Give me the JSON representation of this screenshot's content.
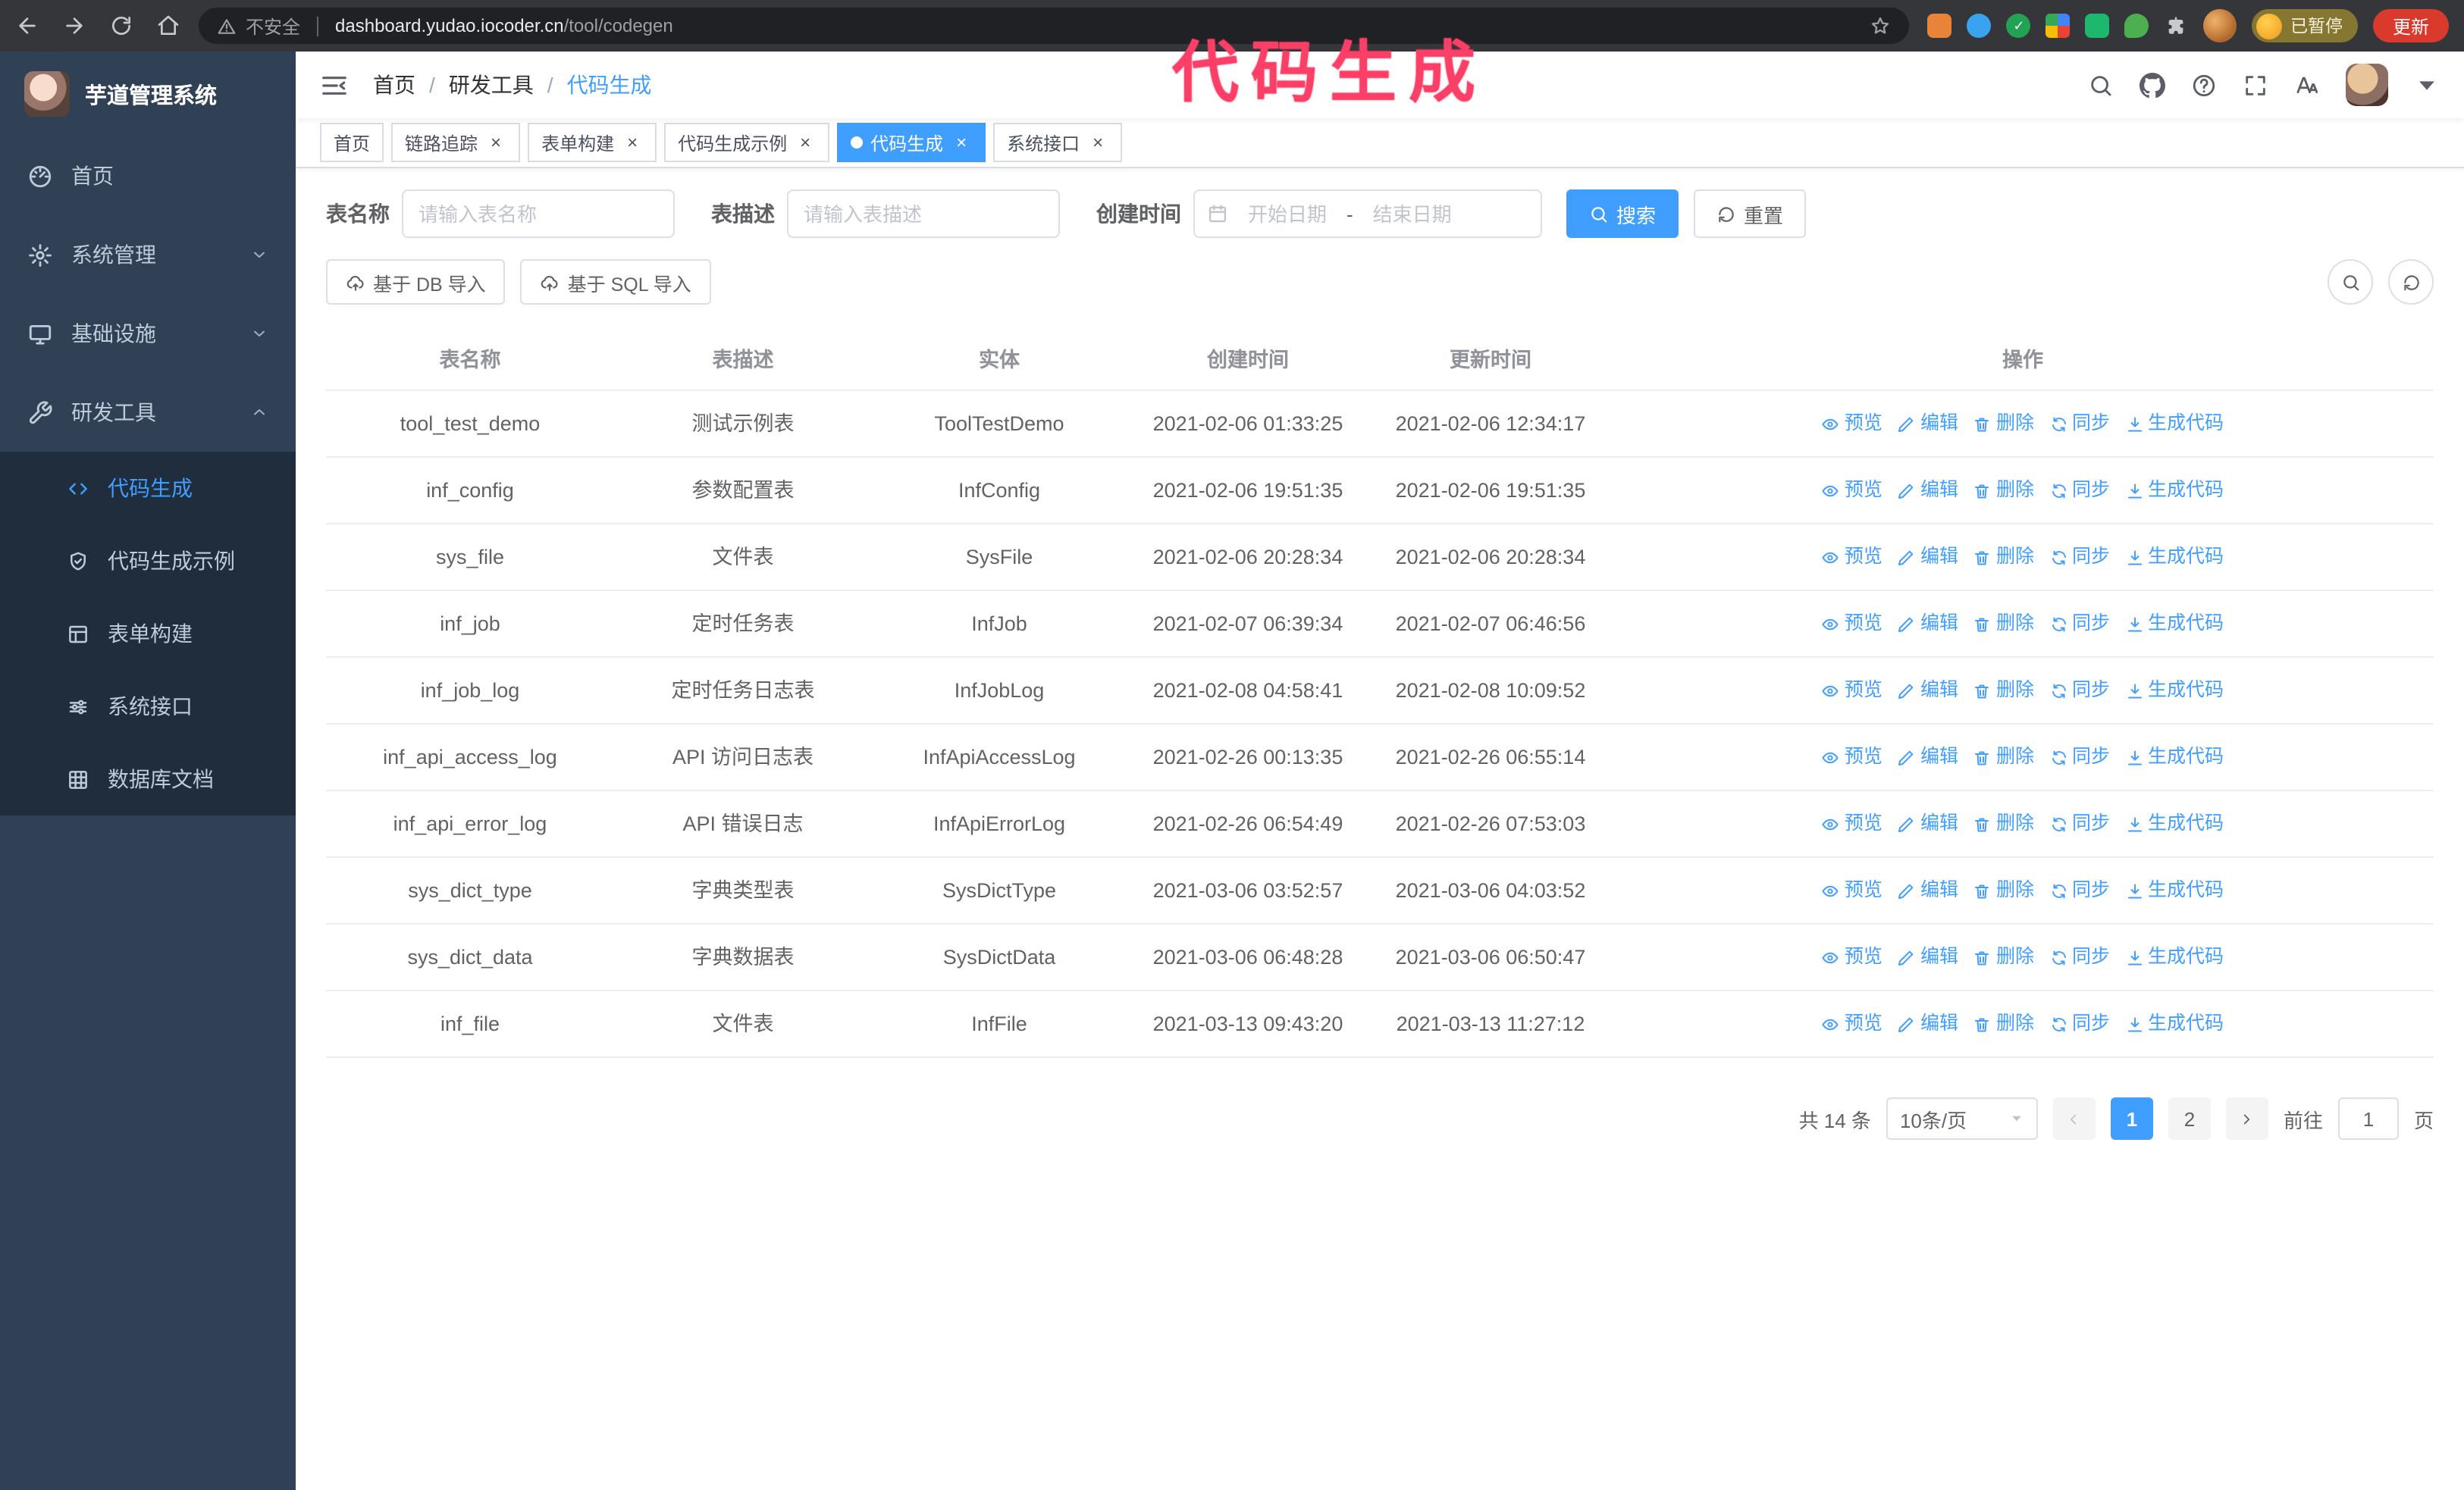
{
  "annotation": {
    "text": "代码生成",
    "color": "#fb3f66"
  },
  "browser": {
    "security_label": "不安全",
    "url_host": "dashboard.yudao.iocoder.cn",
    "url_path": "/tool/codegen",
    "profile_badge": "已暂停",
    "update_button": "更新",
    "extensions": [
      "orange-extension-icon",
      "blue-drop-extension-icon",
      "green-check-extension-icon",
      "people-extension-icon",
      "green-card-extension-icon",
      "leaf-extension-icon",
      "puzzle-icon"
    ]
  },
  "sidebar": {
    "logo_title": "芋道管理系统",
    "items": [
      {
        "label": "首页",
        "icon": "dashboard-icon"
      },
      {
        "label": "系统管理",
        "icon": "gear-icon"
      },
      {
        "label": "基础设施",
        "icon": "monitor-icon"
      },
      {
        "label": "研发工具",
        "icon": "wrench-icon"
      }
    ],
    "submenu": [
      {
        "label": "代码生成",
        "icon": "code-icon",
        "active": true
      },
      {
        "label": "代码生成示例",
        "icon": "shield-check-icon"
      },
      {
        "label": "表单构建",
        "icon": "form-icon"
      },
      {
        "label": "系统接口",
        "icon": "sliders-icon"
      },
      {
        "label": "数据库文档",
        "icon": "grid-icon"
      }
    ]
  },
  "navbar": {
    "breadcrumb": [
      "首页",
      "研发工具",
      "代码生成"
    ],
    "separator": "/"
  },
  "tabs": [
    {
      "label": "首页"
    },
    {
      "label": "链路追踪"
    },
    {
      "label": "表单构建"
    },
    {
      "label": "代码生成示例"
    },
    {
      "label": "代码生成"
    },
    {
      "label": "系统接口"
    }
  ],
  "filters": {
    "table_name_label": "表名称",
    "table_name_placeholder": "请输入表名称",
    "table_desc_label": "表描述",
    "table_desc_placeholder": "请输入表描述",
    "create_time_label": "创建时间",
    "date_start_placeholder": "开始日期",
    "date_separator": "-",
    "date_end_placeholder": "结束日期",
    "search_button": "搜索",
    "reset_button": "重置"
  },
  "toolbar": {
    "import_db": "基于 DB 导入",
    "import_sql": "基于 SQL 导入"
  },
  "table": {
    "columns": [
      "表名称",
      "表描述",
      "实体",
      "创建时间",
      "更新时间",
      "操作"
    ],
    "actions": [
      {
        "label": "预览",
        "icon": "eye",
        "name": "preview-action"
      },
      {
        "label": "编辑",
        "icon": "pen",
        "name": "edit-action"
      },
      {
        "label": "删除",
        "icon": "trash",
        "name": "delete-action"
      },
      {
        "label": "同步",
        "icon": "sync",
        "name": "sync-action"
      },
      {
        "label": "生成代码",
        "icon": "download",
        "name": "generate-code-action"
      }
    ],
    "rows": [
      {
        "name": "tool_test_demo",
        "desc": "测试示例表",
        "entity": "ToolTestDemo",
        "created": "2021-02-06 01:33:25",
        "updated": "2021-02-06 12:34:17"
      },
      {
        "name": "inf_config",
        "desc": "参数配置表",
        "entity": "InfConfig",
        "created": "2021-02-06 19:51:35",
        "updated": "2021-02-06 19:51:35"
      },
      {
        "name": "sys_file",
        "desc": "文件表",
        "entity": "SysFile",
        "created": "2021-02-06 20:28:34",
        "updated": "2021-02-06 20:28:34"
      },
      {
        "name": "inf_job",
        "desc": "定时任务表",
        "entity": "InfJob",
        "created": "2021-02-07 06:39:34",
        "updated": "2021-02-07 06:46:56"
      },
      {
        "name": "inf_job_log",
        "desc": "定时任务日志表",
        "entity": "InfJobLog",
        "created": "2021-02-08 04:58:41",
        "updated": "2021-02-08 10:09:52"
      },
      {
        "name": "inf_api_access_log",
        "desc": "API 访问日志表",
        "entity": "InfApiAccessLog",
        "created": "2021-02-26 00:13:35",
        "updated": "2021-02-26 06:55:14"
      },
      {
        "name": "inf_api_error_log",
        "desc": "API 错误日志",
        "entity": "InfApiErrorLog",
        "created": "2021-02-26 06:54:49",
        "updated": "2021-02-26 07:53:03"
      },
      {
        "name": "sys_dict_type",
        "desc": "字典类型表",
        "entity": "SysDictType",
        "created": "2021-03-06 03:52:57",
        "updated": "2021-03-06 04:03:52"
      },
      {
        "name": "sys_dict_data",
        "desc": "字典数据表",
        "entity": "SysDictData",
        "created": "2021-03-06 06:48:28",
        "updated": "2021-03-06 06:50:47"
      },
      {
        "name": "inf_file",
        "desc": "文件表",
        "entity": "InfFile",
        "created": "2021-03-13 09:43:20",
        "updated": "2021-03-13 11:27:12"
      }
    ]
  },
  "pagination": {
    "total": "共 14 条",
    "page_size": "10条/页",
    "pages": [
      "1",
      "2"
    ],
    "active_page": "1",
    "goto_label": "前往",
    "goto_value": "1",
    "goto_suffix": "页"
  },
  "colors": {
    "primary": "#409eff",
    "sidebar_bg": "#304156",
    "submenu_bg": "#1f2d3d",
    "annotation": "#fb3f66"
  }
}
